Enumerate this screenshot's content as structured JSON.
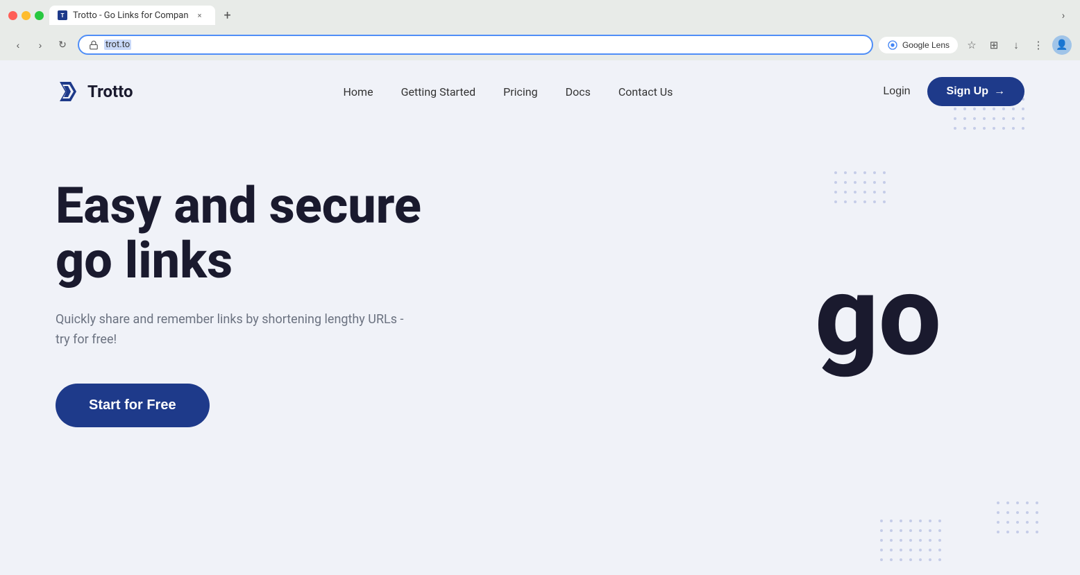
{
  "browser": {
    "tab_title": "Trotto - Go Links for Compan",
    "tab_close": "×",
    "tab_new": "+",
    "nav_back": "‹",
    "nav_forward": "›",
    "nav_reload": "↻",
    "address": "trot.to",
    "google_lens_label": "Google Lens",
    "browser_chevron": "›"
  },
  "nav": {
    "logo_text": "Trotto",
    "links": [
      {
        "label": "Home",
        "id": "home"
      },
      {
        "label": "Getting Started",
        "id": "getting-started"
      },
      {
        "label": "Pricing",
        "id": "pricing"
      },
      {
        "label": "Docs",
        "id": "docs"
      },
      {
        "label": "Contact Us",
        "id": "contact"
      }
    ],
    "login_label": "Login",
    "signup_label": "Sign Up",
    "signup_arrow": "→"
  },
  "hero": {
    "heading_line1": "Easy and secure",
    "heading_line2": "go links",
    "subtext": "Quickly share and remember links by shortening lengthy URLs - try for free!",
    "cta_label": "Start for Free",
    "big_go": "go"
  },
  "colors": {
    "primary": "#1e3a8a",
    "background": "#f0f2f8",
    "text_dark": "#1a1a2e",
    "text_muted": "#6b7280",
    "dot_color": "#c5cce8"
  }
}
